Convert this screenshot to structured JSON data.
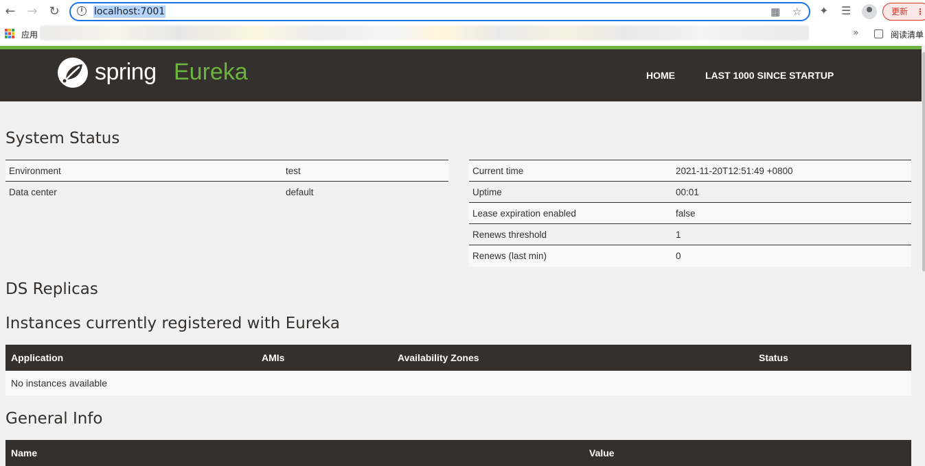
{
  "browser": {
    "url": "localhost:7001",
    "update_label": "更新",
    "apps_label": "应用",
    "reading_list_label": "阅读清单",
    "bookmarks_overflow": "»"
  },
  "brand": {
    "spring": "spring",
    "eureka": "Eureka",
    "green": "#6db33f",
    "dark": "#34302d"
  },
  "nav": {
    "home": "HOME",
    "last1000": "LAST 1000 SINCE STARTUP"
  },
  "system_status": {
    "title": "System Status",
    "left": [
      {
        "label": "Environment",
        "value": "test"
      },
      {
        "label": "Data center",
        "value": "default"
      }
    ],
    "right": [
      {
        "label": "Current time",
        "value": "2021-11-20T12:51:49 +0800"
      },
      {
        "label": "Uptime",
        "value": "00:01"
      },
      {
        "label": "Lease expiration enabled",
        "value": "false"
      },
      {
        "label": "Renews threshold",
        "value": "1"
      },
      {
        "label": "Renews (last min)",
        "value": "0"
      }
    ]
  },
  "ds_replicas": {
    "title": "DS Replicas"
  },
  "instances": {
    "title": "Instances currently registered with Eureka",
    "headers": [
      "Application",
      "AMIs",
      "Availability Zones",
      "Status"
    ],
    "empty": "No instances available"
  },
  "general_info": {
    "title": "General Info",
    "headers": [
      "Name",
      "Value"
    ]
  }
}
